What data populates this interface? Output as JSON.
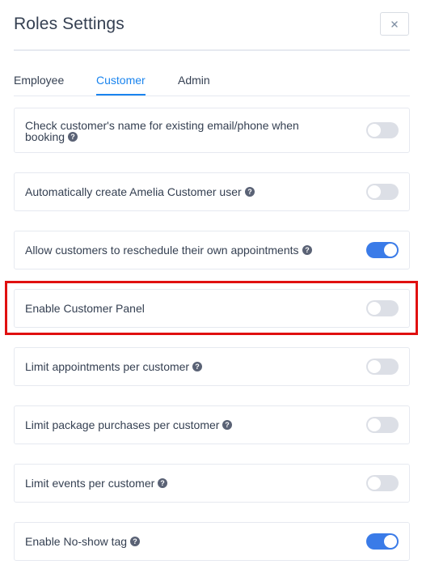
{
  "dialog": {
    "title": "Roles Settings",
    "close_icon": "close-icon"
  },
  "tabs": [
    {
      "label": "Employee",
      "active": false
    },
    {
      "label": "Customer",
      "active": true
    },
    {
      "label": "Admin",
      "active": false
    }
  ],
  "settings": [
    {
      "line1": "Check customer's name for existing email/phone when",
      "line2": "booking",
      "help": true,
      "enabled": false
    },
    {
      "label": "Automatically create Amelia Customer user",
      "help": true,
      "enabled": false
    },
    {
      "label": "Allow customers to reschedule their own appointments",
      "help": true,
      "enabled": true
    },
    {
      "label": "Enable Customer Panel",
      "help": false,
      "enabled": false,
      "highlighted": true
    },
    {
      "label": "Limit appointments per customer",
      "help": true,
      "enabled": false
    },
    {
      "label": "Limit package purchases per customer",
      "help": true,
      "enabled": false
    },
    {
      "label": "Limit events per customer",
      "help": true,
      "enabled": false
    },
    {
      "label": "Enable No-show tag",
      "help": true,
      "enabled": true
    }
  ],
  "colors": {
    "accent": "#1a84ee",
    "toggle_on": "#3a7be8",
    "toggle_off": "#dcdfe6",
    "highlight": "#e01010"
  }
}
